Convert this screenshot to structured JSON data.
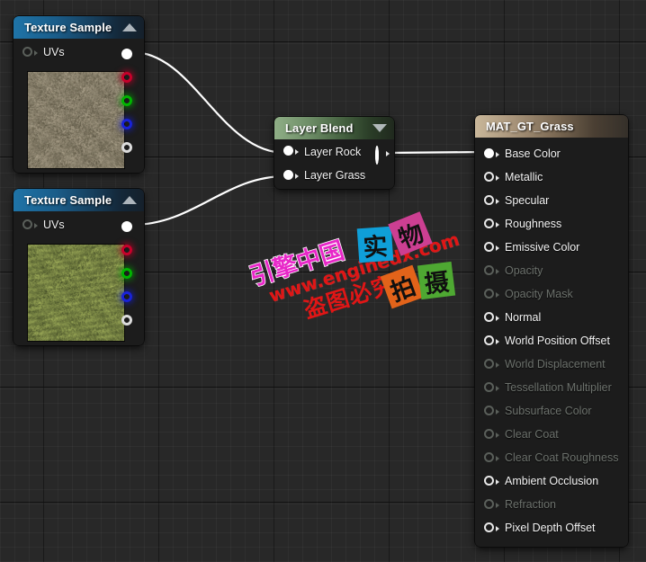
{
  "app": {
    "context": "unreal-material-graph"
  },
  "nodes": {
    "texture_rock": {
      "title": "Texture Sample",
      "collapse_icon": "chevron-up-icon",
      "input_pin": "UVs",
      "outputs": [
        "RGB",
        "R",
        "G",
        "B",
        "A"
      ],
      "thumbnail_kind": "rock-gravel"
    },
    "texture_grass": {
      "title": "Texture Sample",
      "collapse_icon": "chevron-up-icon",
      "input_pin": "UVs",
      "outputs": [
        "RGB",
        "R",
        "G",
        "B",
        "A"
      ],
      "thumbnail_kind": "grass"
    },
    "layer_blend": {
      "title": "Layer Blend",
      "collapse_icon": "chevron-down-icon",
      "inputs": [
        "Layer Rock",
        "Layer Grass"
      ],
      "has_output": true
    },
    "material": {
      "title": "MAT_GT_Grass",
      "pins": [
        {
          "label": "Base Color",
          "enabled": true,
          "connected": true
        },
        {
          "label": "Metallic",
          "enabled": true,
          "connected": false
        },
        {
          "label": "Specular",
          "enabled": true,
          "connected": false
        },
        {
          "label": "Roughness",
          "enabled": true,
          "connected": false
        },
        {
          "label": "Emissive Color",
          "enabled": true,
          "connected": false
        },
        {
          "label": "Opacity",
          "enabled": false,
          "connected": false
        },
        {
          "label": "Opacity Mask",
          "enabled": false,
          "connected": false
        },
        {
          "label": "Normal",
          "enabled": true,
          "connected": false
        },
        {
          "label": "World Position Offset",
          "enabled": true,
          "connected": false
        },
        {
          "label": "World Displacement",
          "enabled": false,
          "connected": false
        },
        {
          "label": "Tessellation Multiplier",
          "enabled": false,
          "connected": false
        },
        {
          "label": "Subsurface Color",
          "enabled": false,
          "connected": false
        },
        {
          "label": "Clear Coat",
          "enabled": false,
          "connected": false
        },
        {
          "label": "Clear Coat Roughness",
          "enabled": false,
          "connected": false
        },
        {
          "label": "Ambient Occlusion",
          "enabled": true,
          "connected": false
        },
        {
          "label": "Refraction",
          "enabled": false,
          "connected": false
        },
        {
          "label": "Pixel Depth Offset",
          "enabled": true,
          "connected": false
        }
      ]
    }
  },
  "watermark": {
    "brand": "引擎中国",
    "url": "www.enginedx.com",
    "warning": "盗图必究",
    "tiles": [
      {
        "char": "实",
        "color": "#0f9fd8"
      },
      {
        "char": "物",
        "color": "#cc3f92"
      },
      {
        "char": "拍",
        "color": "#e2631a"
      },
      {
        "char": "摄",
        "color": "#4ea832"
      }
    ]
  },
  "colors": {
    "canvas_bg": "#282828",
    "node_body": "#1c1c1c",
    "texture_header": "#1f74a8",
    "layerblend_header": "#8fae86",
    "material_header": "#c9b79a",
    "wire": "#ffffff",
    "pin_enabled": "#e8e8e8",
    "pin_disabled": "#5a5f5a"
  }
}
